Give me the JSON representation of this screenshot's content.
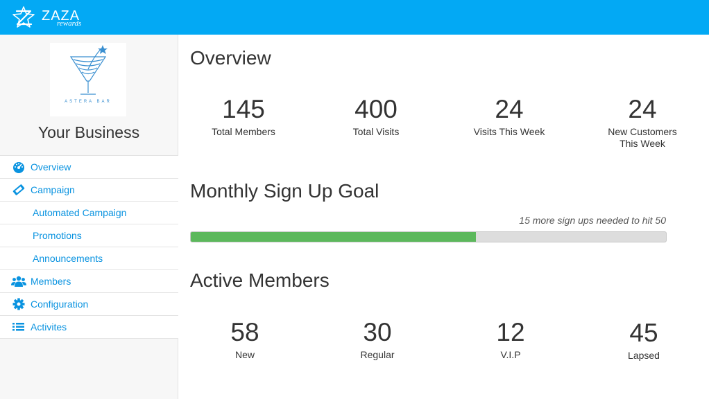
{
  "header": {
    "logo_text": "ZAZA",
    "logo_sub": "rewards",
    "logo_icon": "star-swirl-logo-icon",
    "bg_color": "#03a9f4"
  },
  "sidebar": {
    "business_name": "Your Business",
    "business_logo_text": "ASTERA BAR",
    "items": [
      {
        "label": "Overview",
        "icon": "dashboard-icon"
      },
      {
        "label": "Campaign",
        "icon": "ticket-icon"
      },
      {
        "label": "Automated Campaign"
      },
      {
        "label": "Promotions"
      },
      {
        "label": "Announcements"
      },
      {
        "label": "Members",
        "icon": "users-icon"
      },
      {
        "label": "Configuration",
        "icon": "gear-icon"
      },
      {
        "label": "Activites",
        "icon": "list-icon"
      }
    ]
  },
  "overview": {
    "title": "Overview",
    "stats": [
      {
        "value": "145",
        "label": "Total Members"
      },
      {
        "value": "400",
        "label": "Total Visits"
      },
      {
        "value": "24",
        "label": "Visits This Week"
      },
      {
        "value": "24",
        "label": "New Customers This Week"
      }
    ]
  },
  "goal": {
    "title": "Monthly Sign Up Goal",
    "note": "15 more sign ups needed to hit 50",
    "progress_fraction": 0.6,
    "fill_color": "#5cb85c"
  },
  "active": {
    "title": "Active Members",
    "stats": [
      {
        "value": "58",
        "label": "New"
      },
      {
        "value": "30",
        "label": "Regular"
      },
      {
        "value": "12",
        "label": "V.I.P"
      },
      {
        "value": "45",
        "label": "Lapsed"
      }
    ]
  }
}
